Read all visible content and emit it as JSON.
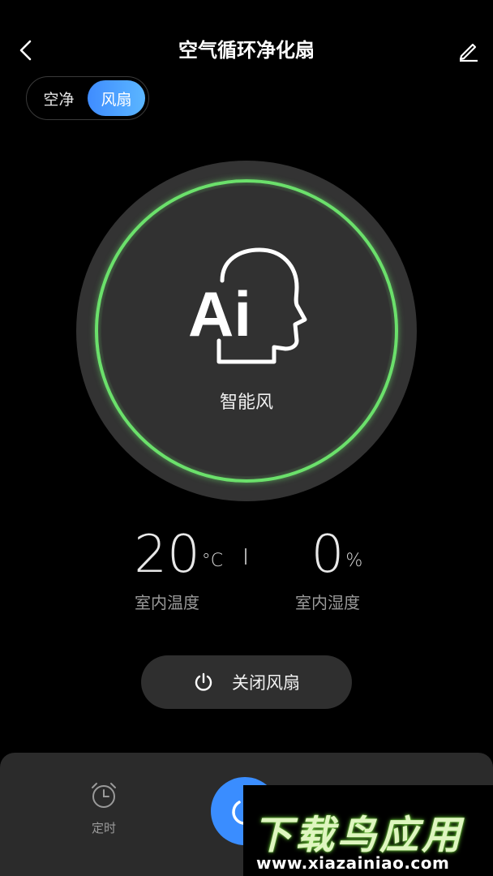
{
  "header": {
    "title": "空气循环净化扇"
  },
  "mode_toggle": {
    "options": [
      "空净",
      "风扇"
    ],
    "selected": "风扇"
  },
  "dial": {
    "icon_text": "Ai",
    "mode_label": "智能风",
    "ring_color": "#6be06b"
  },
  "readings": {
    "temperature": {
      "value": "20",
      "unit": "°C",
      "label": "室内温度"
    },
    "humidity": {
      "value": "0",
      "unit": "%",
      "label": "室内湿度"
    }
  },
  "power_button": {
    "label": "关闭风扇"
  },
  "bottom": {
    "timer_label": "定时"
  },
  "watermark": {
    "logo": "下载鸟应用",
    "url": "www.xiazainiao.com"
  },
  "colors": {
    "accent": "#3a8dff",
    "background": "#000000"
  }
}
